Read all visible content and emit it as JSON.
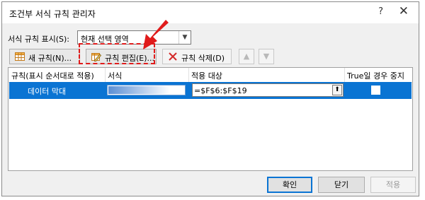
{
  "window": {
    "title": "조건부 서식 규칙 관리자",
    "help_label": "?",
    "close_label": "✕"
  },
  "scope": {
    "label": "서식 규칙 표시(S):",
    "selected": "현재 선택 영역"
  },
  "toolbar": {
    "new_rule_label": "새 규칙(N)...",
    "edit_rule_label": "규칙 편집(E)...",
    "delete_rule_label": "규칙 삭제(D)",
    "move_up_glyph": "▲",
    "move_down_glyph": "▼"
  },
  "grid": {
    "columns": [
      "규칙(표시 순서대로 적용)",
      "서식",
      "적용 대상",
      "True일 경우 중지"
    ],
    "rows": [
      {
        "rule": "데이터 막대",
        "format_bar_level": 0.8,
        "applies_to": "=$F$6:$F$19",
        "stop_if_true": false
      }
    ]
  },
  "buttons": {
    "ok": "확인",
    "close": "닫기",
    "apply": "적용"
  },
  "colors": {
    "selection": "#0a74d3",
    "highlight": "#e01b1b",
    "databar": "#5b8fd4"
  }
}
